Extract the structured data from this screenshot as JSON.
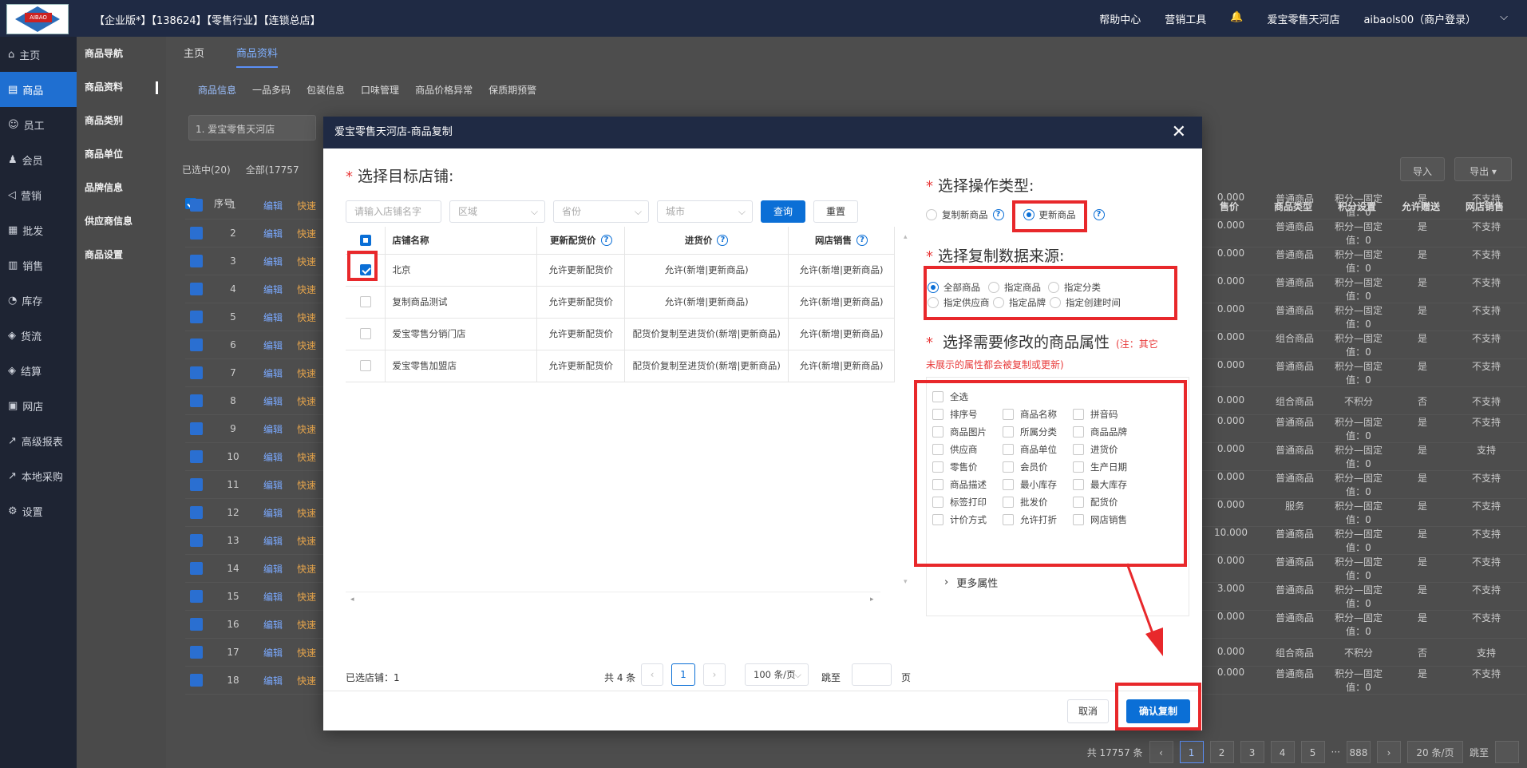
{
  "topbar": {
    "title": "【企业版*】【138624】【零售行业】【连锁总店】",
    "links": [
      "帮助中心",
      "营销工具",
      "爱宝零售天河店",
      "aibaols00（商户登录）"
    ],
    "logo_text": "AIBAO"
  },
  "sidebar": {
    "items": [
      {
        "label": "主页",
        "icon": "home-icon"
      },
      {
        "label": "商品",
        "icon": "goods-icon"
      },
      {
        "label": "员工",
        "icon": "staff-icon"
      },
      {
        "label": "会员",
        "icon": "member-icon"
      },
      {
        "label": "营销",
        "icon": "megaphone-icon"
      },
      {
        "label": "批发",
        "icon": "wholesale-icon"
      },
      {
        "label": "销售",
        "icon": "chart-icon"
      },
      {
        "label": "库存",
        "icon": "stock-icon"
      },
      {
        "label": "货流",
        "icon": "flow-icon"
      },
      {
        "label": "结算",
        "icon": "settle-icon"
      },
      {
        "label": "网店",
        "icon": "shop-icon"
      },
      {
        "label": "高级报表",
        "icon": "report-icon"
      },
      {
        "label": "本地采购",
        "icon": "purchase-icon"
      },
      {
        "label": "设置",
        "icon": "gear-icon"
      }
    ]
  },
  "subnav": {
    "items": [
      "商品导航",
      "商品资料",
      "商品类别",
      "商品单位",
      "品牌信息",
      "供应商信息",
      "商品设置"
    ]
  },
  "page_tabs": [
    "主页",
    "商品资料"
  ],
  "sub_tabs": [
    "商品信息",
    "一品多码",
    "包装信息",
    "口味管理",
    "商品价格异常",
    "保质期预警"
  ],
  "bg": {
    "store_select": "1. 爱宝零售天河店",
    "selected_radio": "已选中(20)",
    "all_radio": "全部(17757",
    "import": "导入",
    "export": "导出",
    "col_seq": "序号",
    "col_headers": [
      "售价",
      "商品类型",
      "积分设置",
      "允许赠送",
      "网店销售"
    ],
    "rows": [
      {
        "n": "1",
        "price": "0.000",
        "type": "普通商品",
        "pts": "积分—固定值：0",
        "gift": "是",
        "web": "不支持"
      },
      {
        "n": "2",
        "price": "0.000",
        "type": "普通商品",
        "pts": "积分—固定值：0",
        "gift": "是",
        "web": "不支持"
      },
      {
        "n": "3",
        "price": "0.000",
        "type": "普通商品",
        "pts": "积分—固定值：0",
        "gift": "是",
        "web": "不支持"
      },
      {
        "n": "4",
        "price": "0.000",
        "type": "普通商品",
        "pts": "积分—固定值：0",
        "gift": "是",
        "web": "不支持"
      },
      {
        "n": "5",
        "price": "0.000",
        "type": "普通商品",
        "pts": "积分—固定值：0",
        "gift": "是",
        "web": "不支持"
      },
      {
        "n": "6",
        "price": "0.000",
        "type": "组合商品",
        "pts": "积分—固定值：0",
        "gift": "是",
        "web": "不支持"
      },
      {
        "n": "7",
        "price": "0.000",
        "type": "普通商品",
        "pts": "积分—固定值：0",
        "gift": "是",
        "web": "不支持"
      },
      {
        "n": "8",
        "price": "0.000",
        "type": "组合商品",
        "pts": "不积分",
        "gift": "否",
        "web": "不支持"
      },
      {
        "n": "9",
        "price": "0.000",
        "type": "普通商品",
        "pts": "积分—固定值：0",
        "gift": "是",
        "web": "不支持"
      },
      {
        "n": "10",
        "price": "0.000",
        "type": "普通商品",
        "pts": "积分—固定值：0",
        "gift": "是",
        "web": "支持"
      },
      {
        "n": "11",
        "price": "0.000",
        "type": "普通商品",
        "pts": "积分—固定值：0",
        "gift": "是",
        "web": "不支持"
      },
      {
        "n": "12",
        "price": "0.000",
        "type": "服务",
        "pts": "积分—固定值：0",
        "gift": "是",
        "web": "不支持"
      },
      {
        "n": "13",
        "price": "10.000",
        "type": "普通商品",
        "pts": "积分—固定值：0",
        "gift": "是",
        "web": "不支持"
      },
      {
        "n": "14",
        "price": "0.000",
        "type": "普通商品",
        "pts": "积分—固定值：0",
        "gift": "是",
        "web": "不支持"
      },
      {
        "n": "15",
        "price": "3.000",
        "type": "普通商品",
        "pts": "积分—固定值：0",
        "gift": "是",
        "web": "不支持"
      },
      {
        "n": "16",
        "price": "0.000",
        "type": "普通商品",
        "pts": "积分—固定值：0",
        "gift": "是",
        "web": "不支持"
      },
      {
        "n": "17",
        "price": "0.000",
        "type": "组合商品",
        "pts": "不积分",
        "gift": "否",
        "web": "支持"
      },
      {
        "n": "18",
        "price": "0.000",
        "type": "普通商品",
        "pts": "积分—固定值：0",
        "gift": "是",
        "web": "不支持"
      }
    ],
    "edit_label": "编辑",
    "quick_label": "快速",
    "total": "共 17757 条",
    "pages": [
      "1",
      "2",
      "3",
      "4",
      "5",
      "888"
    ],
    "per_page": "20 条/页",
    "jump": "跳至"
  },
  "modal": {
    "title": "爱宝零售天河店-商品复制",
    "target_title": "选择目标店铺:",
    "search_placeholder": "请输入店铺名字",
    "area": "区域",
    "province": "省份",
    "city": "城市",
    "query": "查询",
    "reset": "重置",
    "columns": [
      "店铺名称",
      "更新配货价",
      "进货价",
      "网店销售"
    ],
    "stores": [
      {
        "name": "北京",
        "dist": "允许更新配货价",
        "purchase": "允许(新增|更新商品)",
        "web": "允许(新增|更新商品)",
        "checked": true
      },
      {
        "name": "复制商品测试",
        "dist": "允许更新配货价",
        "purchase": "允许(新增|更新商品)",
        "web": "允许(新增|更新商品)",
        "checked": false
      },
      {
        "name": "爱宝零售分销门店",
        "dist": "允许更新配货价",
        "purchase": "配货价复制至进货价(新增|更新商品)",
        "web": "允许(新增|更新商品)",
        "checked": false
      },
      {
        "name": "爱宝零售加盟店",
        "dist": "允许更新配货价",
        "purchase": "配货价复制至进货价(新增|更新商品)",
        "web": "允许(新增|更新商品)",
        "checked": false
      }
    ],
    "selected_count": "已选店铺：1",
    "total": "共 4 条",
    "page": "1",
    "per_page": "100 条/页",
    "jump": "跳至",
    "page_unit": "页",
    "op_title": "选择操作类型:",
    "op_options": [
      "复制新商品",
      "更新商品"
    ],
    "op_selected": "更新商品",
    "src_title": "选择复制数据来源:",
    "src_options": [
      "全部商品",
      "指定商品",
      "指定分类",
      "指定供应商",
      "指定品牌",
      "指定创建时间"
    ],
    "src_selected": "全部商品",
    "attr_title": "选择需要修改的商品属性",
    "attr_note_a": "(注：其它",
    "attr_note_b": "未展示的属性都会被复制或更新)",
    "select_all": "全选",
    "attrs": [
      "排序号",
      "商品名称",
      "拼音码",
      "商品图片",
      "所属分类",
      "商品品牌",
      "供应商",
      "商品单位",
      "进货价",
      "零售价",
      "会员价",
      "生产日期",
      "商品描述",
      "最小库存",
      "最大库存",
      "标签打印",
      "批发价",
      "配货价",
      "计价方式",
      "允许打折",
      "网店销售"
    ],
    "more_attrs": "更多属性",
    "cancel": "取消",
    "confirm": "确认复制"
  },
  "colors": {
    "primary": "#0b6fd6",
    "highlight": "#e8282b",
    "header": "#1f2a44"
  }
}
